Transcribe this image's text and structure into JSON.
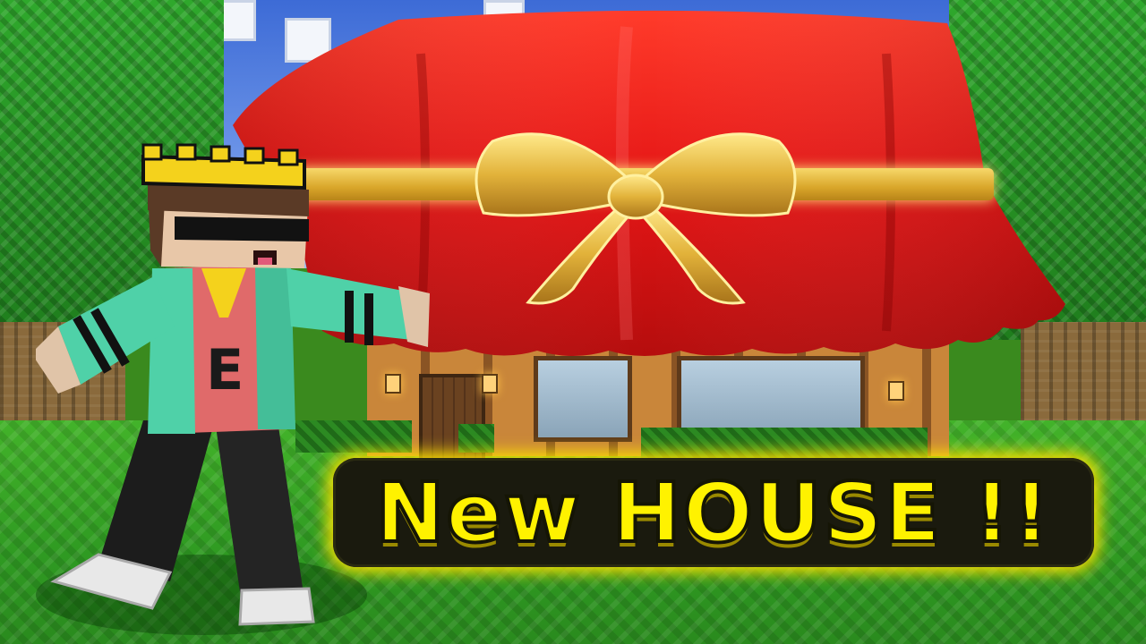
{
  "thumbnail": {
    "title": "New HOUSE !!",
    "title_color": "#fff200",
    "cloth_color": "#e51616",
    "ribbon_color": "#e2b23a",
    "grass_color": "#3aa825"
  },
  "character": {
    "shirt_letter": "E",
    "crown_color": "#f4d21c",
    "jacket_color": "#4fd1a8"
  }
}
